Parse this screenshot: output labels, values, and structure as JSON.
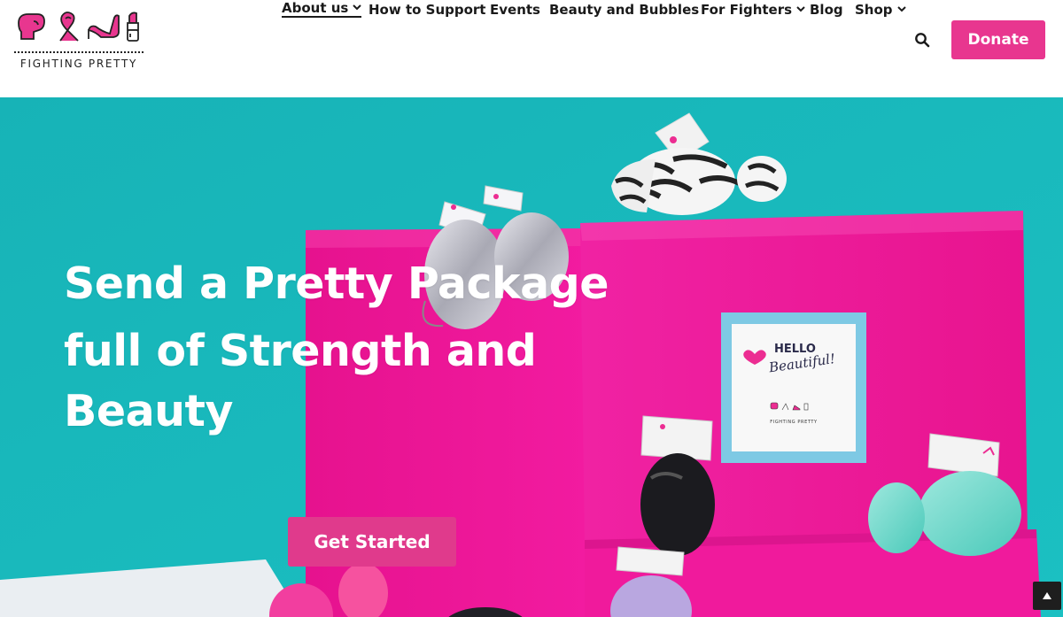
{
  "brand": {
    "logo_text": "FIGHTING PRETTY",
    "accent": "#e8368f",
    "icons": [
      "boxing-glove-icon",
      "ribbon-icon",
      "high-heel-icon",
      "lipstick-icon"
    ]
  },
  "nav": {
    "items": [
      {
        "label": "About us",
        "has_dropdown": true,
        "active": true
      },
      {
        "label": "How to Support",
        "has_dropdown": false
      },
      {
        "label": "Events",
        "has_dropdown": false
      },
      {
        "label": "Beauty and Bubbles",
        "has_dropdown": false
      },
      {
        "label": "For Fighters",
        "has_dropdown": true
      },
      {
        "label": "Blog",
        "has_dropdown": false
      },
      {
        "label": "Shop",
        "has_dropdown": true
      }
    ],
    "search_icon": "search-icon",
    "donate_label": "Donate"
  },
  "hero": {
    "title_lines": [
      "Send a Pretty Package",
      "full of Strength and",
      "Beauty"
    ],
    "cta_label": "Get Started",
    "card_hello": "HELLO",
    "card_beautiful": "Beautiful!",
    "card_brand": "FIGHTING PRETTY",
    "background_color": "#1fb5b9",
    "box_color": "#f0189c"
  },
  "scroll_top_icon": "arrow-up-icon"
}
